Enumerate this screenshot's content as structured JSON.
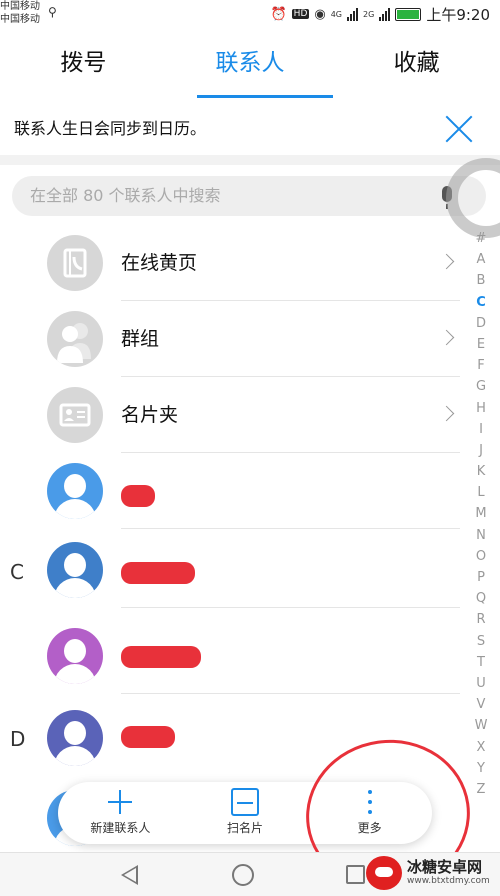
{
  "status_bar": {
    "carrier_1": "中国移动",
    "carrier_2": "中国移动",
    "network_1": "4G",
    "network_2": "2G",
    "hd_badge": "HD",
    "time": "上午9:20",
    "battery_color": "#2bb33f"
  },
  "tabs": [
    {
      "label": "拨号"
    },
    {
      "label": "联系人"
    },
    {
      "label": "收藏"
    }
  ],
  "banner": {
    "text": "联系人生日会同步到日历。"
  },
  "search": {
    "placeholder": "在全部 80 个联系人中搜索"
  },
  "list": {
    "special_rows": [
      {
        "label": "在线黄页",
        "icon": "yellow-pages-icon"
      },
      {
        "label": "群组",
        "icon": "group-icon"
      },
      {
        "label": "名片夹",
        "icon": "business-card-icon"
      }
    ],
    "section_letters": [
      "C",
      "D"
    ]
  },
  "index_bar": [
    "#",
    "A",
    "B",
    "C",
    "D",
    "E",
    "F",
    "G",
    "H",
    "I",
    "J",
    "K",
    "L",
    "M",
    "N",
    "O",
    "P",
    "Q",
    "R",
    "S",
    "T",
    "U",
    "V",
    "W",
    "X",
    "Y",
    "Z"
  ],
  "index_active": "C",
  "actions": [
    {
      "label": "新建联系人",
      "icon": "plus-icon"
    },
    {
      "label": "扫名片",
      "icon": "scan-icon"
    },
    {
      "label": "更多",
      "icon": "more-icon"
    }
  ],
  "watermark": {
    "title": "冰糖安卓网",
    "url": "www.btxtdmy.com"
  },
  "colors": {
    "accent": "#1a8be8",
    "redaction": "#e8313a"
  }
}
